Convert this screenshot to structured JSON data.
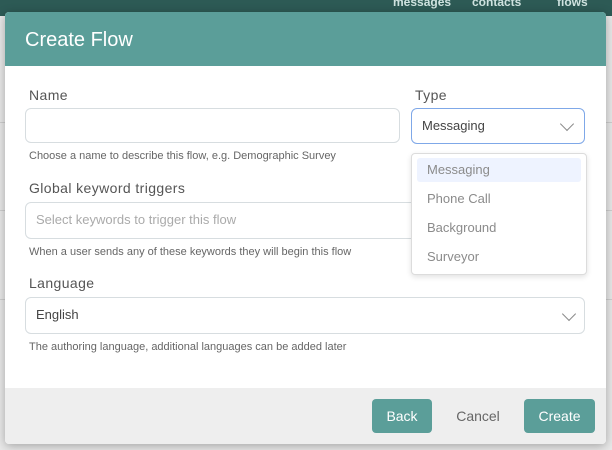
{
  "background": {
    "nav": [
      "messages",
      "contacts",
      "flows"
    ]
  },
  "dialog": {
    "title": "Create Flow",
    "name": {
      "label": "Name",
      "value": "",
      "help": "Choose a name to describe this flow, e.g. Demographic Survey"
    },
    "type": {
      "label": "Type",
      "value": "Messaging",
      "options": [
        "Messaging",
        "Phone Call",
        "Background",
        "Surveyor"
      ],
      "highlighted": "Messaging"
    },
    "keywords": {
      "label": "Global keyword triggers",
      "placeholder": "Select keywords to trigger this flow",
      "help": "When a user sends any of these keywords they will begin this flow"
    },
    "language": {
      "label": "Language",
      "value": "English",
      "help": "The authoring language, additional languages can be added later"
    },
    "buttons": {
      "back": "Back",
      "cancel": "Cancel",
      "create": "Create"
    },
    "colors": {
      "accent": "#5b9e99",
      "topbar": "#2d5a55"
    }
  }
}
